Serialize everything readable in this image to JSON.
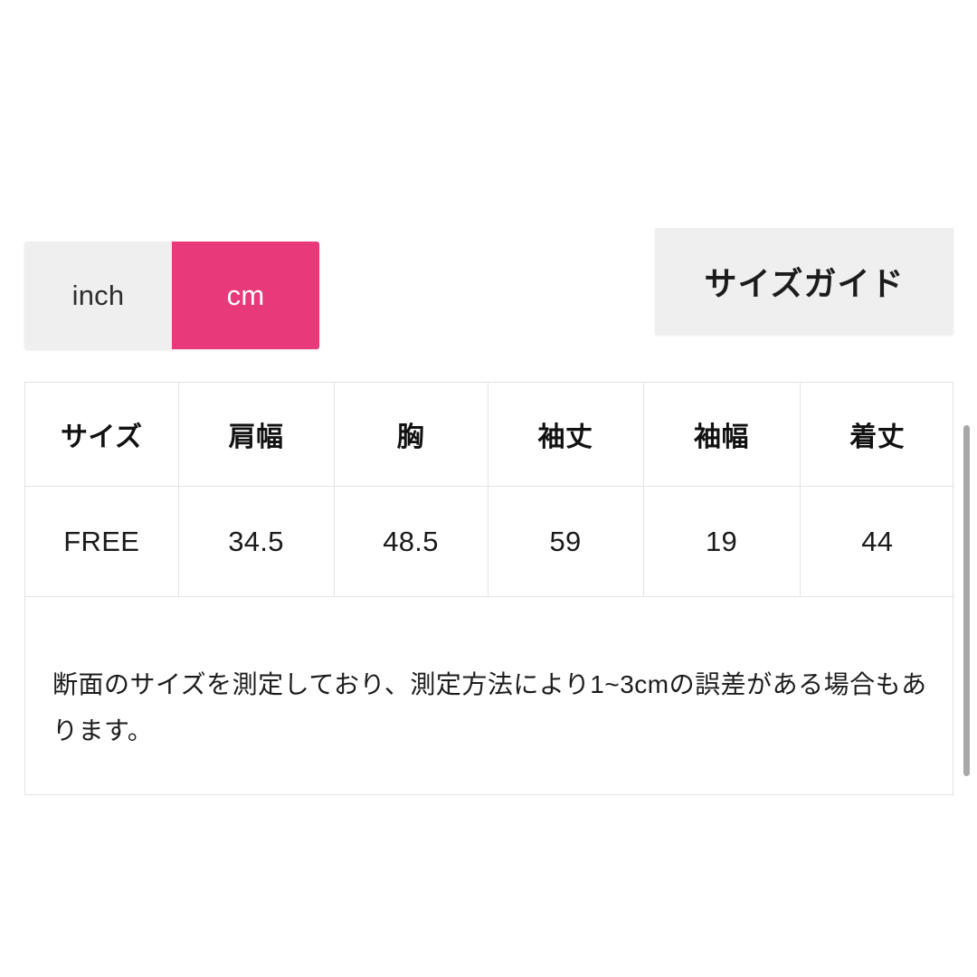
{
  "page": {
    "background_color": "#ffffff"
  },
  "unit_toggle": {
    "name": "unit-toggle",
    "selected": "cm",
    "active_color": "#e8397a",
    "inactive_color": "#efefef",
    "options": [
      {
        "label": "inch",
        "value": "inch",
        "selected": false
      },
      {
        "label": "cm",
        "value": "cm",
        "selected": true
      }
    ]
  },
  "heading": {
    "text": "サイズガイド",
    "background_color": "#efefef"
  },
  "size_table": {
    "headers": [
      "サイズ",
      "肩幅",
      "胸",
      "袖丈",
      "袖幅",
      "着丈"
    ],
    "rows": [
      [
        "FREE",
        "34.5",
        "48.5",
        "59",
        "19",
        "44"
      ]
    ],
    "note": "断面のサイズを測定しており、測定方法により1~3cmの誤差がある場合もあります。"
  },
  "scrollbar": {
    "name": "page-scrollbar",
    "thumb_color": "#a8a8a8"
  }
}
